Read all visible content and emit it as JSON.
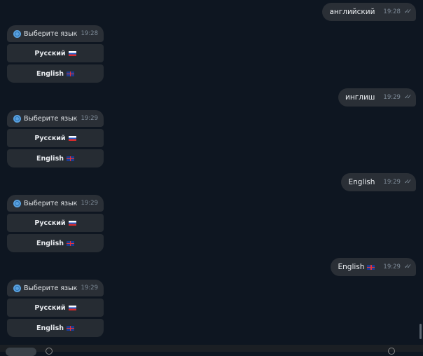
{
  "outgoing": [
    {
      "text": "английский",
      "time": "19:28",
      "flag": ""
    },
    {
      "text": "инглиш",
      "time": "19:29",
      "flag": ""
    },
    {
      "text": "English",
      "time": "19:29",
      "flag": ""
    },
    {
      "text": "English",
      "time": "19:29",
      "flag": "gb"
    }
  ],
  "bot": [
    {
      "prompt": "Выберите язык",
      "time": "19:28",
      "btn_ru": "Русский",
      "btn_en": "English"
    },
    {
      "prompt": "Выберите язык",
      "time": "19:29",
      "btn_ru": "Русский",
      "btn_en": "English"
    },
    {
      "prompt": "Выберите язык",
      "time": "19:29",
      "btn_ru": "Русский",
      "btn_en": "English"
    },
    {
      "prompt": "Выберите язык",
      "time": "19:29",
      "btn_ru": "Русский",
      "btn_en": "English"
    }
  ],
  "icons": {
    "read": "double-check-icon",
    "globe": "globe-icon"
  }
}
